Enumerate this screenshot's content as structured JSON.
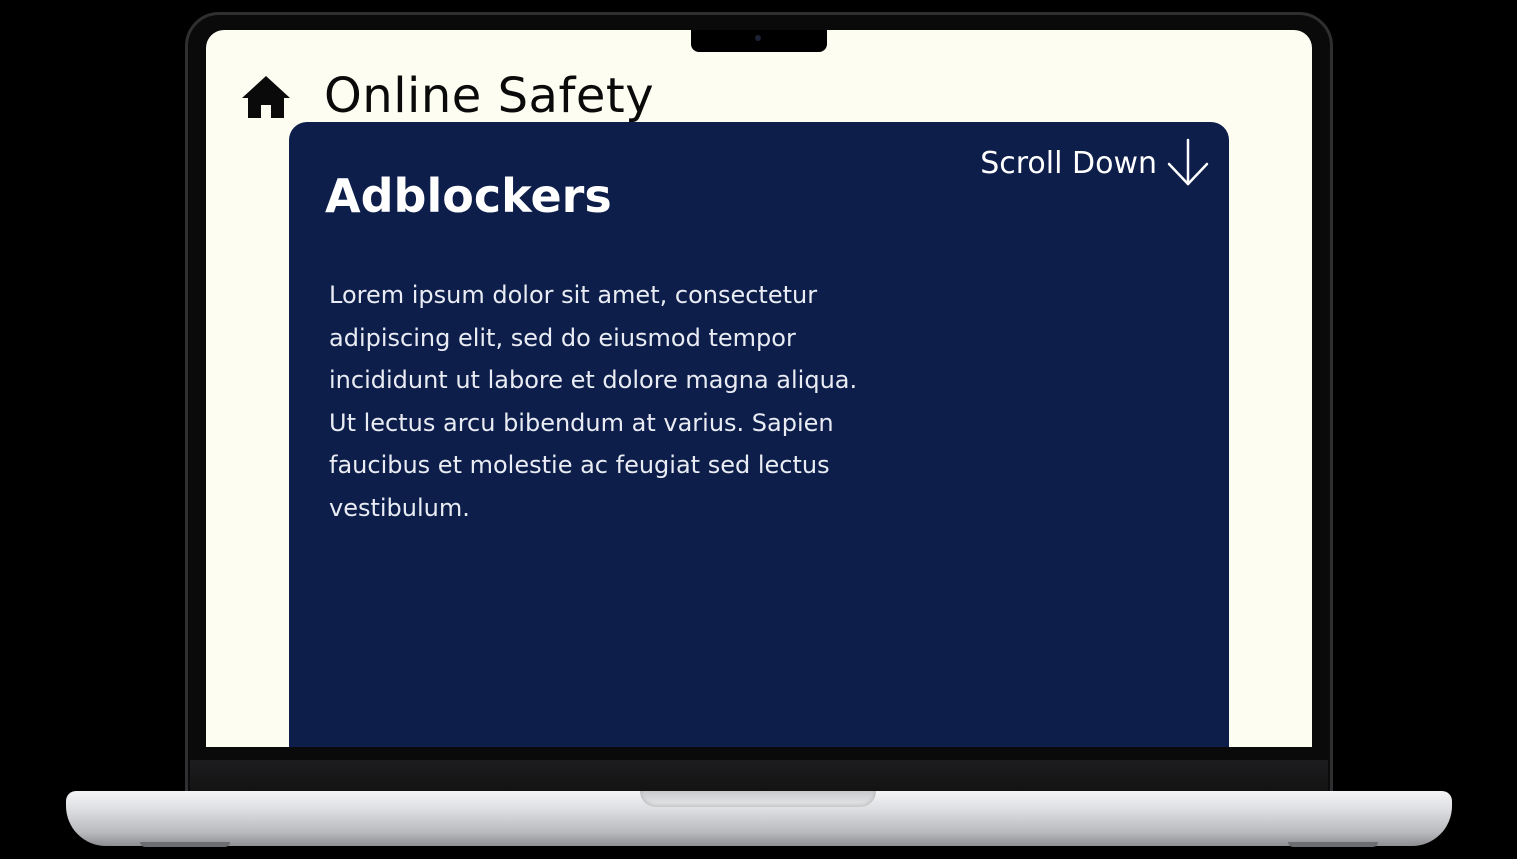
{
  "header": {
    "home_icon": "home-icon",
    "title": "Online Safety"
  },
  "card": {
    "heading": "Adblockers",
    "scroll_label": "Scroll Down",
    "scroll_icon": "arrow-down-icon",
    "body": "Lorem ipsum dolor sit amet, consectetur adipiscing elit, sed do eiusmod tempor incididunt ut labore et dolore magna aliqua. Ut lectus arcu bibendum at varius. Sapien faucibus et molestie ac feugiat sed lectus vestibulum."
  },
  "colors": {
    "page_background": "#fdfdf2",
    "card_background": "#0d1e4b",
    "text_dark": "#0a0a0a",
    "text_light": "#ffffff"
  }
}
